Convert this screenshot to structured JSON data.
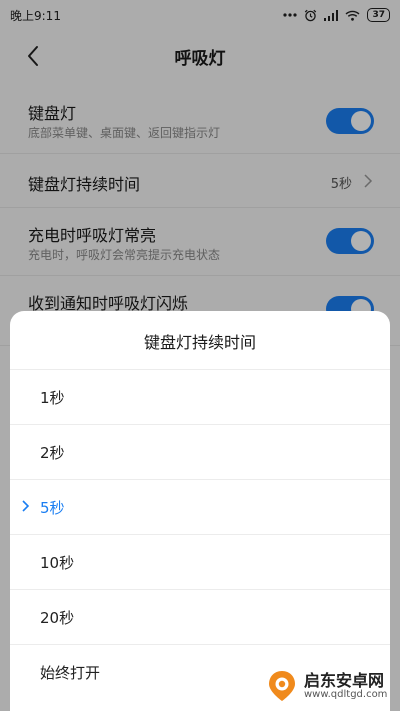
{
  "statusbar": {
    "time": "晚上9:11",
    "battery": "37"
  },
  "header": {
    "title": "呼吸灯"
  },
  "settings": [
    {
      "title": "键盘灯",
      "subtitle": "底部菜单键、桌面键、返回键指示灯",
      "toggle_on": true
    },
    {
      "title": "键盘灯持续时间",
      "value": "5秒"
    },
    {
      "title": "充电时呼吸灯常亮",
      "subtitle": "充电时，呼吸灯会常亮提示充电状态",
      "toggle_on": true
    },
    {
      "title": "收到通知时呼吸灯闪烁",
      "toggle_on": true
    }
  ],
  "dialog": {
    "title": "键盘灯持续时间",
    "options": [
      {
        "label": "1秒",
        "selected": false
      },
      {
        "label": "2秒",
        "selected": false
      },
      {
        "label": "5秒",
        "selected": true
      },
      {
        "label": "10秒",
        "selected": false
      },
      {
        "label": "20秒",
        "selected": false
      },
      {
        "label": "始终打开",
        "selected": false
      }
    ]
  },
  "watermark": {
    "name": "启东安卓网",
    "url": "www.qdltgd.com"
  },
  "colors": {
    "accent": "#1a7ef2",
    "watermark_orange": "#f08a1c"
  },
  "icons": {
    "back": "back-arrow-icon",
    "chevron": "chevron-right-icon",
    "check": "check-icon"
  }
}
